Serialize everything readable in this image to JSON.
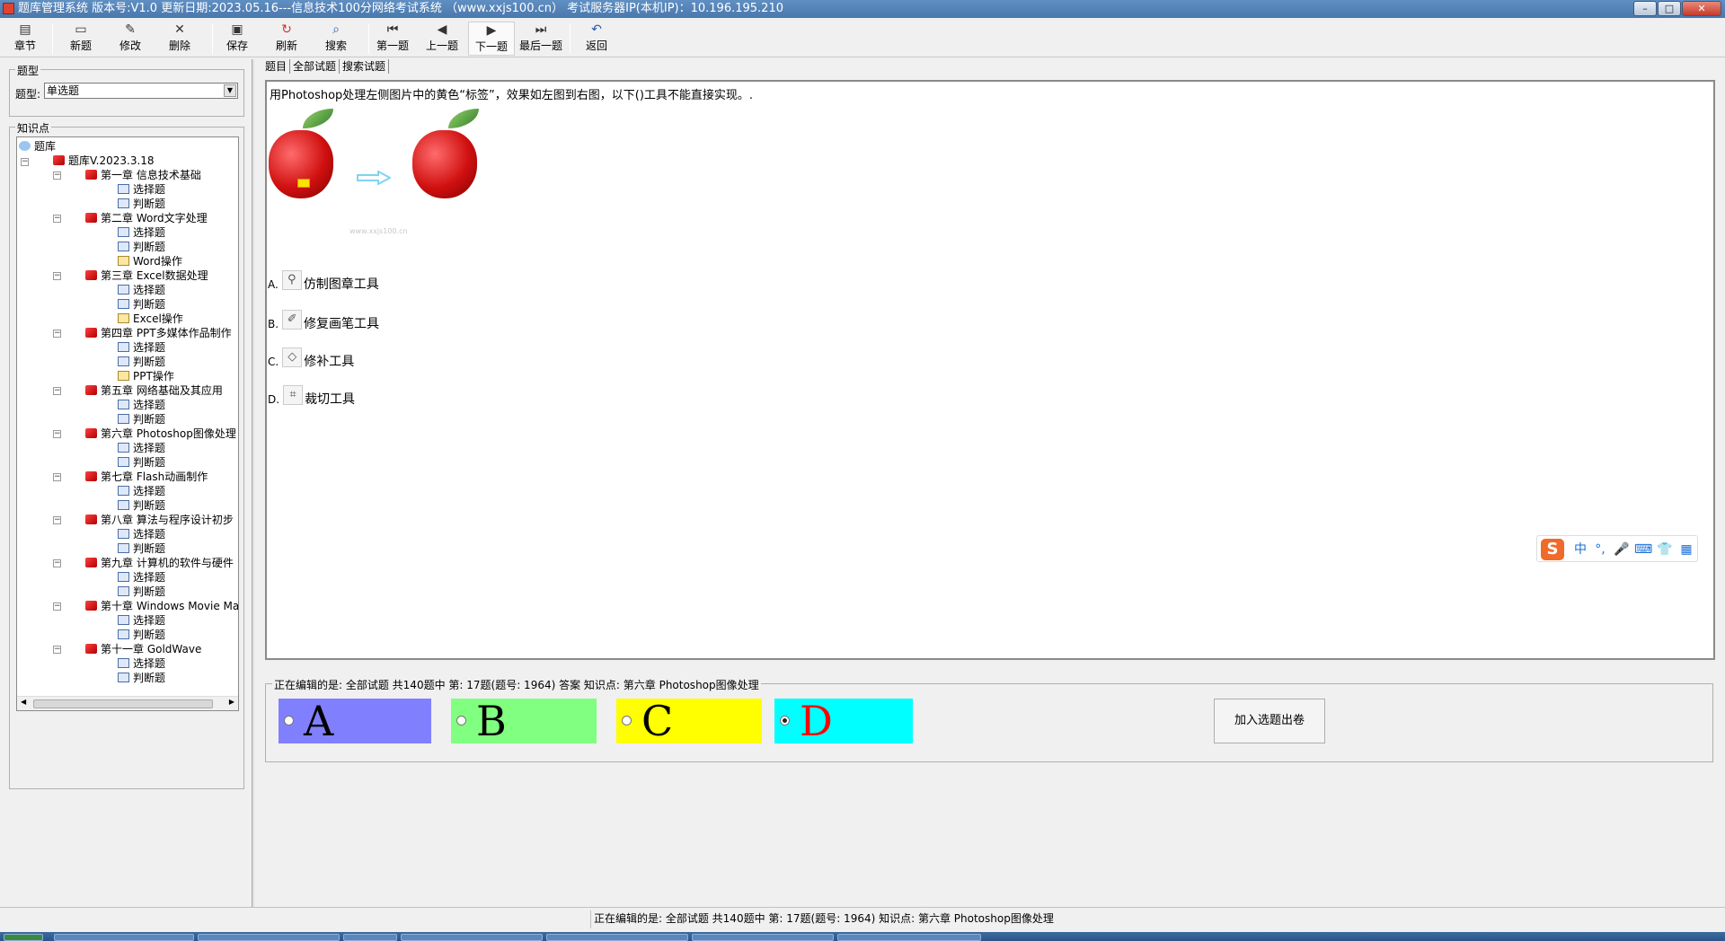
{
  "window": {
    "title": "题库管理系统 版本号:V1.0 更新日期:2023.05.16---信息技术100分网络考试系统 （www.xxjs100.cn） 考试服务器IP(本机IP)：10.196.195.210"
  },
  "toolbar": {
    "buttons": [
      {
        "label": "章节",
        "icon": "chapter-icon"
      },
      {
        "label": "新题",
        "icon": "new-icon"
      },
      {
        "label": "修改",
        "icon": "edit-icon"
      },
      {
        "label": "删除",
        "icon": "delete-icon"
      },
      {
        "label": "保存",
        "icon": "save-icon"
      },
      {
        "label": "刷新",
        "icon": "refresh-icon"
      },
      {
        "label": "搜索",
        "icon": "search-icon"
      },
      {
        "label": "第一题",
        "icon": "first-icon"
      },
      {
        "label": "上一题",
        "icon": "prev-icon"
      },
      {
        "label": "下一题",
        "icon": "next-icon"
      },
      {
        "label": "最后一题",
        "icon": "last-icon"
      },
      {
        "label": "返回",
        "icon": "return-icon"
      }
    ]
  },
  "left": {
    "type_group_title": "题型",
    "type_label": "题型:",
    "type_value": "单选题",
    "knowledge_title": "知识点",
    "tree": {
      "root": "题库",
      "bank": "题库V.2023.3.18",
      "chapters": [
        {
          "label": "第一章 信息技术基础",
          "children": [
            "选择题",
            "判断题"
          ]
        },
        {
          "label": "第二章 Word文字处理",
          "children": [
            "选择题",
            "判断题",
            "Word操作"
          ]
        },
        {
          "label": "第三章 Excel数据处理",
          "children": [
            "选择题",
            "判断题",
            "Excel操作"
          ]
        },
        {
          "label": "第四章 PPT多媒体作品制作",
          "children": [
            "选择题",
            "判断题",
            "PPT操作"
          ]
        },
        {
          "label": "第五章 网络基础及其应用",
          "children": [
            "选择题",
            "判断题"
          ]
        },
        {
          "label": "第六章 Photoshop图像处理",
          "children": [
            "选择题",
            "判断题"
          ]
        },
        {
          "label": "第七章 Flash动画制作",
          "children": [
            "选择题",
            "判断题"
          ]
        },
        {
          "label": "第八章 算法与程序设计初步",
          "children": [
            "选择题",
            "判断题"
          ]
        },
        {
          "label": "第九章 计算机的软件与硬件",
          "children": [
            "选择题",
            "判断题"
          ]
        },
        {
          "label": "第十章 Windows Movie Make",
          "children": [
            "选择题",
            "判断题"
          ]
        },
        {
          "label": "第十一章 GoldWave",
          "children": [
            "选择题",
            "判断题"
          ]
        }
      ]
    }
  },
  "tabs": [
    "题目",
    "全部试题",
    "搜索试题"
  ],
  "question": {
    "text": "用Photoshop处理左侧图片中的黄色“标签”，效果如左图到右图，以下()工具不能直接实现。.",
    "watermark": "www.xxjs100.cn",
    "options": [
      {
        "letter": "A.",
        "text": "仿制图章工具",
        "icon": "clone-stamp-icon"
      },
      {
        "letter": "B.",
        "text": "修复画笔工具",
        "icon": "healing-brush-icon"
      },
      {
        "letter": "C.",
        "text": "修补工具",
        "icon": "patch-icon"
      },
      {
        "letter": "D.",
        "text": "裁切工具",
        "icon": "crop-icon"
      }
    ]
  },
  "ime": {
    "logo": "S",
    "mode": "中",
    "punct": "°,",
    "mic": "🎤",
    "keyboard": "⌨",
    "skin": "👕",
    "menu": "▦"
  },
  "answer": {
    "caption": "正在编辑的是: 全部试题 共140题中  第: 17题(题号: 1964) 答案 知识点: 第六章 Photoshop图像处理",
    "choices": [
      {
        "label": "A",
        "color": "#8080ff",
        "text_color": "#000000",
        "checked": false
      },
      {
        "label": "B",
        "color": "#80ff80",
        "text_color": "#000000",
        "checked": false
      },
      {
        "label": "C",
        "color": "#ffff00",
        "text_color": "#000000",
        "checked": false
      },
      {
        "label": "D",
        "color": "#00ffff",
        "text_color": "#ff0000",
        "checked": true
      }
    ],
    "add_button": "加入选题出卷"
  },
  "status": {
    "text": "正在编辑的是: 全部试题 共140题中  第: 17题(题号: 1964)  知识点: 第六章 Photoshop图像处理"
  }
}
